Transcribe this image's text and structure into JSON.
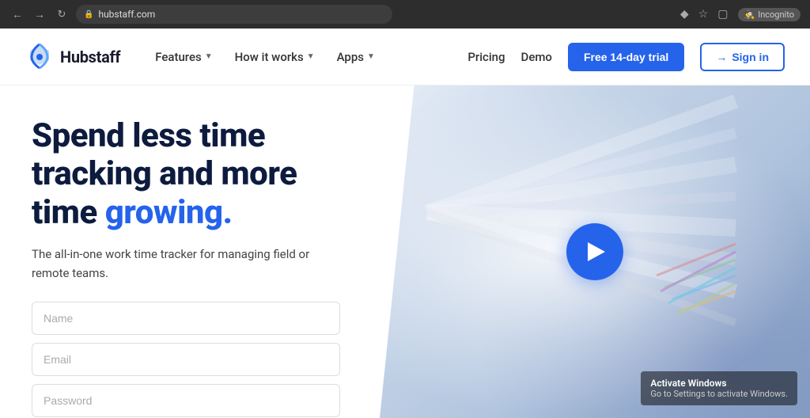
{
  "browser": {
    "url": "hubstaff.com",
    "back_icon": "←",
    "forward_icon": "→",
    "reload_icon": "↺",
    "lock_icon": "🔒",
    "incognito_label": "Incognito",
    "incognito_icon": "🕵"
  },
  "navbar": {
    "logo_text": "Hubstaff",
    "nav_items": [
      {
        "label": "Features",
        "has_dropdown": true
      },
      {
        "label": "How it works",
        "has_dropdown": true
      },
      {
        "label": "Apps",
        "has_dropdown": true
      }
    ],
    "right_links": [
      {
        "label": "Pricing"
      },
      {
        "label": "Demo"
      }
    ],
    "cta_trial": "Free 14-day trial",
    "cta_signin": "Sign in",
    "signin_icon": "→"
  },
  "hero": {
    "heading_line1": "Spend less time",
    "heading_line2": "tracking and more",
    "heading_line3_normal": "time ",
    "heading_line3_highlight": "growing.",
    "subtext": "The all-in-one work time tracker for managing field or remote teams.",
    "form": {
      "name_placeholder": "Name",
      "email_placeholder": "Email",
      "password_placeholder": "Password"
    },
    "play_button_label": "Play video"
  },
  "watermark": {
    "title": "Activate Windows",
    "subtitle": "Go to Settings to activate Windows."
  }
}
